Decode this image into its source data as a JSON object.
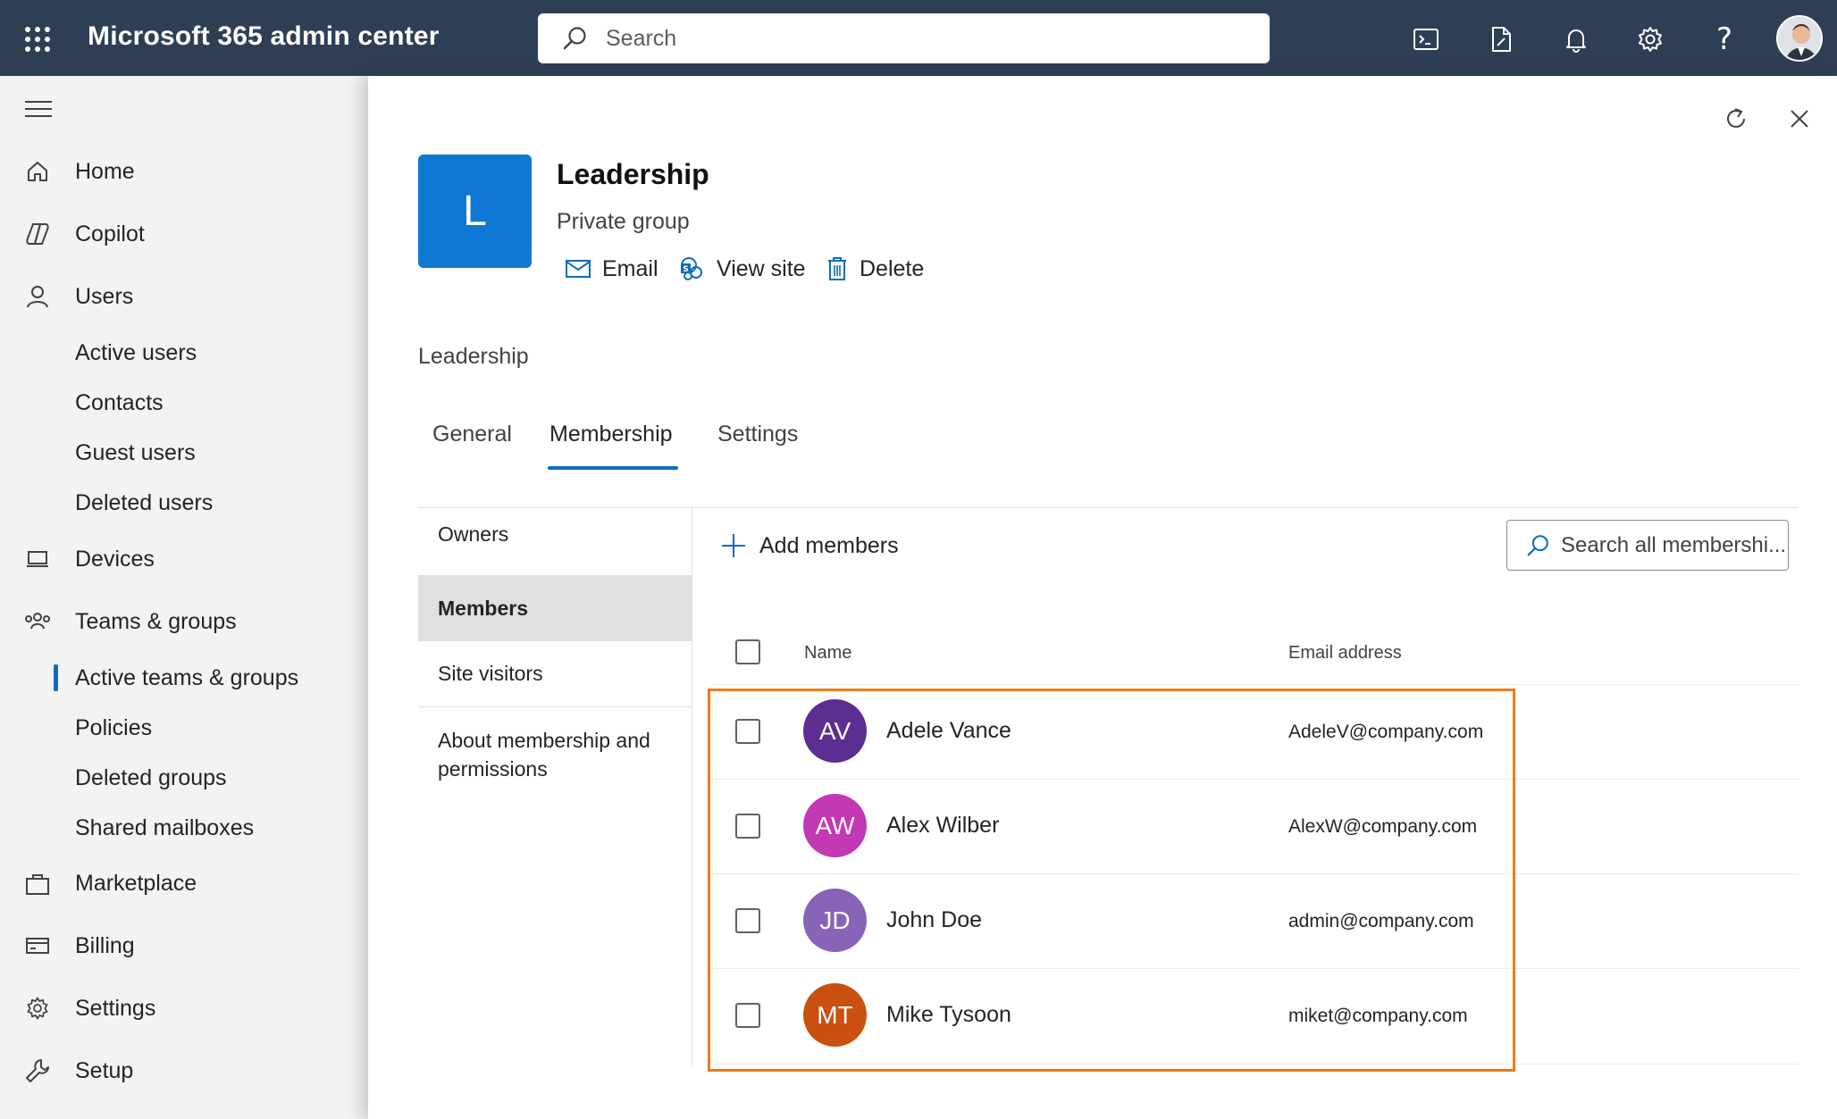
{
  "header": {
    "app_title": "Microsoft 365 admin center",
    "search_placeholder": "Search",
    "icons": [
      "waffle-icon",
      "terminal-icon",
      "document-edit-icon",
      "bell-icon",
      "gear-icon",
      "help-icon",
      "user-avatar"
    ]
  },
  "nav": {
    "items": [
      {
        "label": "Home",
        "icon": "home-icon"
      },
      {
        "label": "Copilot",
        "icon": "copilot-icon"
      },
      {
        "label": "Users",
        "icon": "person-icon"
      },
      {
        "label": "Active users"
      },
      {
        "label": "Contacts"
      },
      {
        "label": "Guest users"
      },
      {
        "label": "Deleted users"
      },
      {
        "label": "Devices",
        "icon": "devices-icon"
      },
      {
        "label": "Teams & groups",
        "icon": "people-team-icon"
      },
      {
        "label": "Active teams & groups",
        "selected": true
      },
      {
        "label": "Policies"
      },
      {
        "label": "Deleted groups"
      },
      {
        "label": "Shared mailboxes"
      },
      {
        "label": "Marketplace",
        "icon": "bag-icon"
      },
      {
        "label": "Billing",
        "icon": "credit-card-icon"
      },
      {
        "label": "Settings",
        "icon": "gear-icon"
      },
      {
        "label": "Setup",
        "icon": "wrench-icon"
      }
    ]
  },
  "panel": {
    "group_initial": "L",
    "group_name": "Leadership",
    "group_type": "Private group",
    "actions": {
      "email": "Email",
      "view_site": "View site",
      "delete": "Delete"
    },
    "breadcrumb": "Leadership",
    "tabs": [
      {
        "label": "General"
      },
      {
        "label": "Membership",
        "active": true
      },
      {
        "label": "Settings"
      }
    ],
    "subnav": [
      {
        "label": "Owners"
      },
      {
        "label": "Members",
        "selected": true
      },
      {
        "label": "Site visitors"
      },
      {
        "label": "About membership and permissions"
      }
    ],
    "add_members": "Add members",
    "search_members_placeholder": "Search all membershi...",
    "columns": {
      "name": "Name",
      "email": "Email address"
    },
    "members": [
      {
        "initials": "AV",
        "name": "Adele Vance",
        "email": "AdeleV@company.com",
        "color": "#5c2e91"
      },
      {
        "initials": "AW",
        "name": "Alex Wilber",
        "email": "AlexW@company.com",
        "color": "#c239b3"
      },
      {
        "initials": "JD",
        "name": "John Doe",
        "email": "admin@company.com",
        "color": "#8764b8"
      },
      {
        "initials": "MT",
        "name": "Mike Tysoon",
        "email": "miket@company.com",
        "color": "#ca5010"
      }
    ],
    "highlight_color": "#f07b14"
  },
  "colors": {
    "topbar": "#2e3f55",
    "accent": "#0f6cbd",
    "group_tile": "#0f78d4"
  }
}
